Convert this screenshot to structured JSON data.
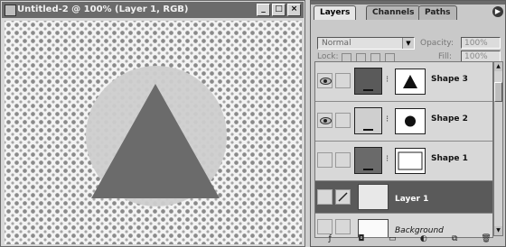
{
  "document": {
    "title": "Untitled-2 @ 100% (Layer 1, RGB)",
    "buttons": [
      "_",
      "□",
      "×"
    ],
    "canvas": {
      "circle_color": "#cdcdcd",
      "triangle_color": "#6b6b6b"
    }
  },
  "palette": {
    "tabs": [
      "Layers",
      "Channels",
      "Paths"
    ],
    "blend_mode": "Normal",
    "opacity_label": "Opacity:",
    "opacity_value": "100%",
    "lock_label": "Lock:",
    "fill_label": "Fill:",
    "fill_value": "100%",
    "layers": [
      {
        "name": "Shape 3",
        "visible": true,
        "thumb_color": "#5a5a5a",
        "mask_shape": "triangle",
        "selected": false
      },
      {
        "name": "Shape 2",
        "visible": true,
        "thumb_color": "#cfcfcf",
        "mask_shape": "ellipse",
        "selected": false
      },
      {
        "name": "Shape 1",
        "visible": false,
        "thumb_color": "#6a6a6a",
        "mask_shape": "rect",
        "selected": false
      },
      {
        "name": "Layer 1",
        "visible": false,
        "selected": true
      },
      {
        "name": "Background",
        "visible": false,
        "selected": false
      }
    ],
    "bottom_icons": [
      "layer-style-icon",
      "add-mask-icon",
      "new-set-icon",
      "adjustment-layer-icon",
      "new-layer-icon",
      "trash-icon"
    ]
  },
  "colors": {
    "titlebar": "#6b6b6b",
    "selected_row": "#5a5a5a"
  }
}
